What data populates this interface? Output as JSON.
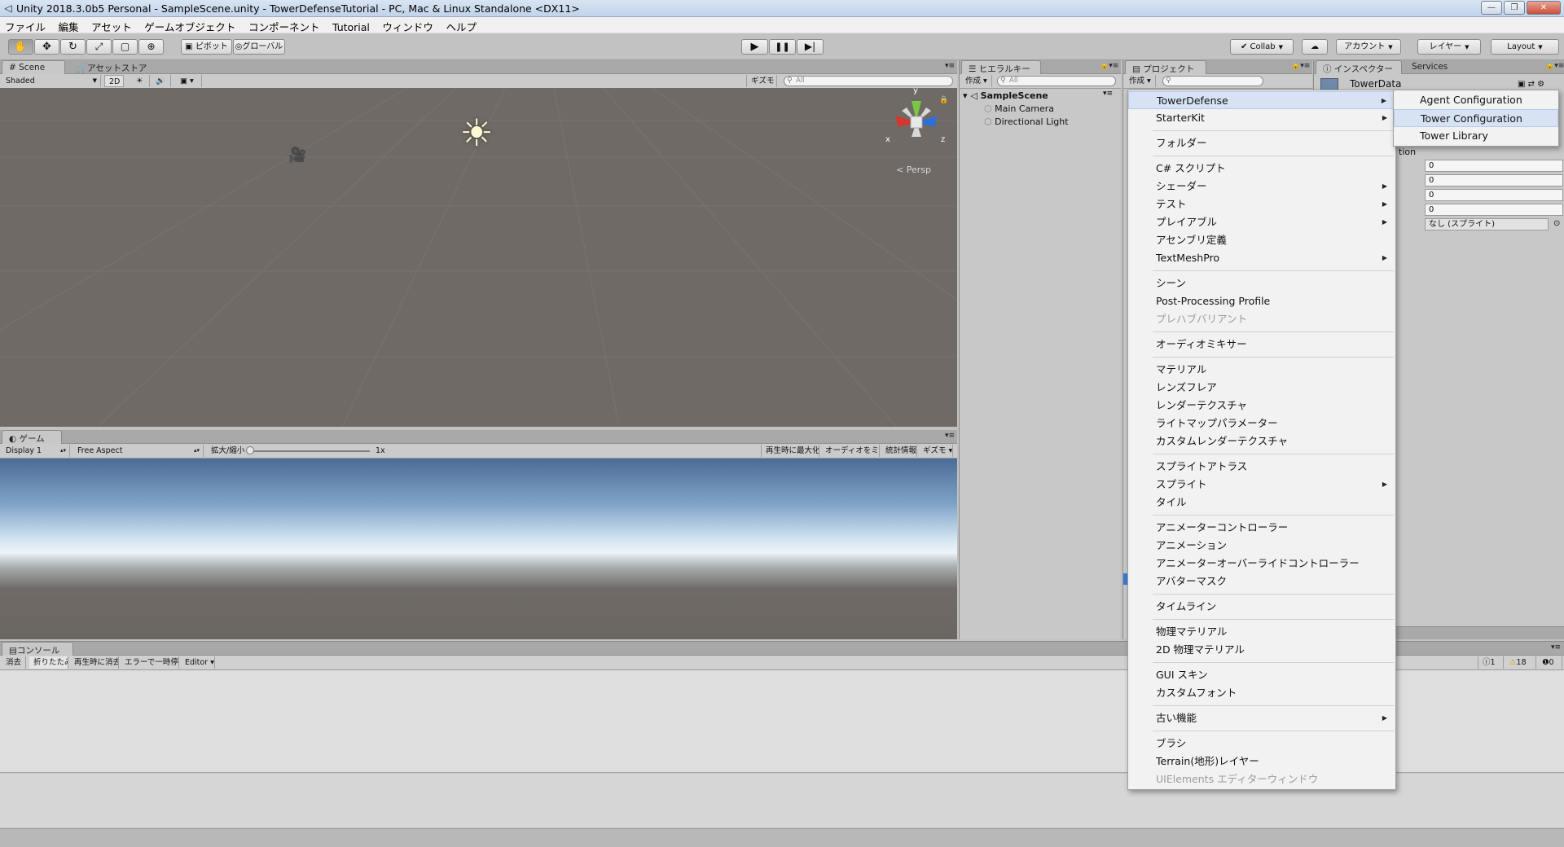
{
  "window": {
    "title": "Unity 2018.3.0b5 Personal - SampleScene.unity - TowerDefenseTutorial - PC, Mac & Linux Standalone <DX11>",
    "minimize": "—",
    "maximize": "❐",
    "close": "✕"
  },
  "menubar": [
    "ファイル",
    "編集",
    "アセット",
    "ゲームオブジェクト",
    "コンポーネント",
    "Tutorial",
    "ウィンドウ",
    "ヘルプ"
  ],
  "toolbar": {
    "pivot": "ピボット",
    "global": "グローバル",
    "collab": "Collab",
    "account": "アカウント",
    "layers": "レイヤー",
    "layout": "Layout"
  },
  "scene_panel": {
    "tab_scene": "Scene",
    "tab_asset_store": "アセットストア",
    "shading": "Shaded",
    "mode_2d": "2D",
    "gizmos": "ギズモ",
    "search_placeholder": "All",
    "persp": "< Persp",
    "axis_x": "x",
    "axis_y": "y",
    "axis_z": "z"
  },
  "game_panel": {
    "tab": "ゲーム",
    "display": "Display 1",
    "aspect": "Free Aspect",
    "scale_label": "拡大/縮小",
    "scale_value": "1x",
    "maximize_on_play": "再生時に最大化",
    "mute_audio": "オーディオをミュート",
    "stats": "統計情報",
    "gizmos": "ギズモ"
  },
  "hierarchy": {
    "tab": "ヒエラルキー",
    "create": "作成",
    "search_placeholder": "All",
    "scene": "SampleScene",
    "items": [
      "Main Camera",
      "Directional Light"
    ]
  },
  "project": {
    "tab": "プロジェクト",
    "create": "作成"
  },
  "inspector": {
    "tab": "インスペクター",
    "tab_services": "Services",
    "object_name": "TowerData",
    "label_fragment": "tion",
    "fields": [
      "0",
      "0",
      "0",
      "0"
    ],
    "sprite_field": "なし (スプライト)"
  },
  "console": {
    "tab": "コンソール",
    "clear": "消去",
    "collapse": "折りたたみ",
    "clear_on_play": "再生時に消去",
    "error_pause": "エラーで一時停止",
    "editor": "Editor",
    "info_count": "1",
    "warning_count": "18",
    "error_count": "0"
  },
  "context_menu": {
    "items": [
      {
        "label": "TowerDefense",
        "submenu": true,
        "highlight": true
      },
      {
        "label": "StarterKit",
        "submenu": true
      },
      {
        "sep": true
      },
      {
        "label": "フォルダー"
      },
      {
        "sep": true
      },
      {
        "label": "C# スクリプト"
      },
      {
        "label": "シェーダー",
        "submenu": true
      },
      {
        "label": "テスト",
        "submenu": true
      },
      {
        "label": "プレイアブル",
        "submenu": true
      },
      {
        "label": "アセンブリ定義"
      },
      {
        "label": "TextMeshPro",
        "submenu": true
      },
      {
        "sep": true
      },
      {
        "label": "シーン"
      },
      {
        "label": "Post-Processing Profile"
      },
      {
        "label": "プレハブバリアント",
        "disabled": true
      },
      {
        "sep": true
      },
      {
        "label": "オーディオミキサー"
      },
      {
        "sep": true
      },
      {
        "label": "マテリアル"
      },
      {
        "label": "レンズフレア"
      },
      {
        "label": "レンダーテクスチャ"
      },
      {
        "label": "ライトマップパラメーター"
      },
      {
        "label": "カスタムレンダーテクスチャ"
      },
      {
        "sep": true
      },
      {
        "label": "スプライトアトラス"
      },
      {
        "label": "スプライト",
        "submenu": true
      },
      {
        "label": "タイル"
      },
      {
        "sep": true
      },
      {
        "label": "アニメーターコントローラー"
      },
      {
        "label": "アニメーション"
      },
      {
        "label": "アニメーターオーバーライドコントローラー"
      },
      {
        "label": "アバターマスク"
      },
      {
        "sep": true
      },
      {
        "label": "タイムライン"
      },
      {
        "sep": true
      },
      {
        "label": "物理マテリアル"
      },
      {
        "label": "2D 物理マテリアル"
      },
      {
        "sep": true
      },
      {
        "label": "GUI スキン"
      },
      {
        "label": "カスタムフォント"
      },
      {
        "sep": true
      },
      {
        "label": "古い機能",
        "submenu": true
      },
      {
        "sep": true
      },
      {
        "label": "ブラシ"
      },
      {
        "label": "Terrain(地形)レイヤー"
      },
      {
        "label": "UIElements エディターウィンドウ",
        "disabled": true
      }
    ]
  },
  "submenu": {
    "items": [
      {
        "label": "Agent Configuration"
      },
      {
        "label": "Tower Configuration",
        "highlight": true
      },
      {
        "label": "Tower Library"
      }
    ]
  },
  "colors": {
    "scene_bg": "#6f6a65",
    "panel_bg": "#c8c8c8",
    "menu_highlight": "#d7e3f4",
    "gizmo_x": "#d9352a",
    "gizmo_y": "#7ac943",
    "gizmo_z": "#2f6fd9"
  }
}
